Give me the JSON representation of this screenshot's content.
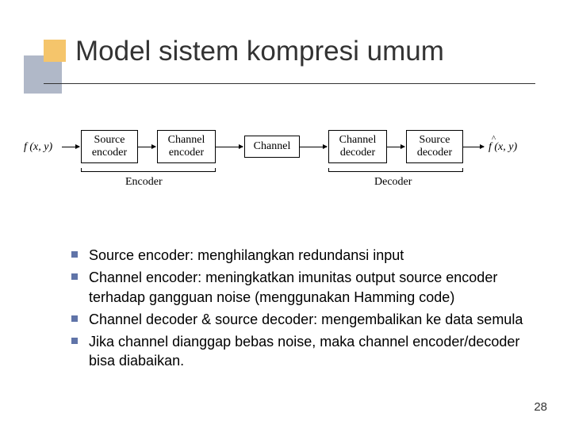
{
  "title": "Model sistem kompresi umum",
  "diagram": {
    "input": "f (x, y)",
    "output": "f (x, y)",
    "blocks": {
      "src_enc_1": "Source",
      "src_enc_2": "encoder",
      "ch_enc_1": "Channel",
      "ch_enc_2": "encoder",
      "channel": "Channel",
      "ch_dec_1": "Channel",
      "ch_dec_2": "decoder",
      "src_dec_1": "Source",
      "src_dec_2": "decoder"
    },
    "groups": {
      "encoder": "Encoder",
      "decoder": "Decoder"
    }
  },
  "bullets": {
    "b1": "Source encoder: menghilangkan redundansi input",
    "b2": "Channel encoder: meningkatkan imunitas output source encoder terhadap gangguan noise (menggunakan Hamming code)",
    "b3": "Channel decoder & source decoder: mengembalikan ke data semula",
    "b4": "Jika channel dianggap bebas noise, maka channel encoder/decoder bisa diabaikan."
  },
  "page": "28"
}
